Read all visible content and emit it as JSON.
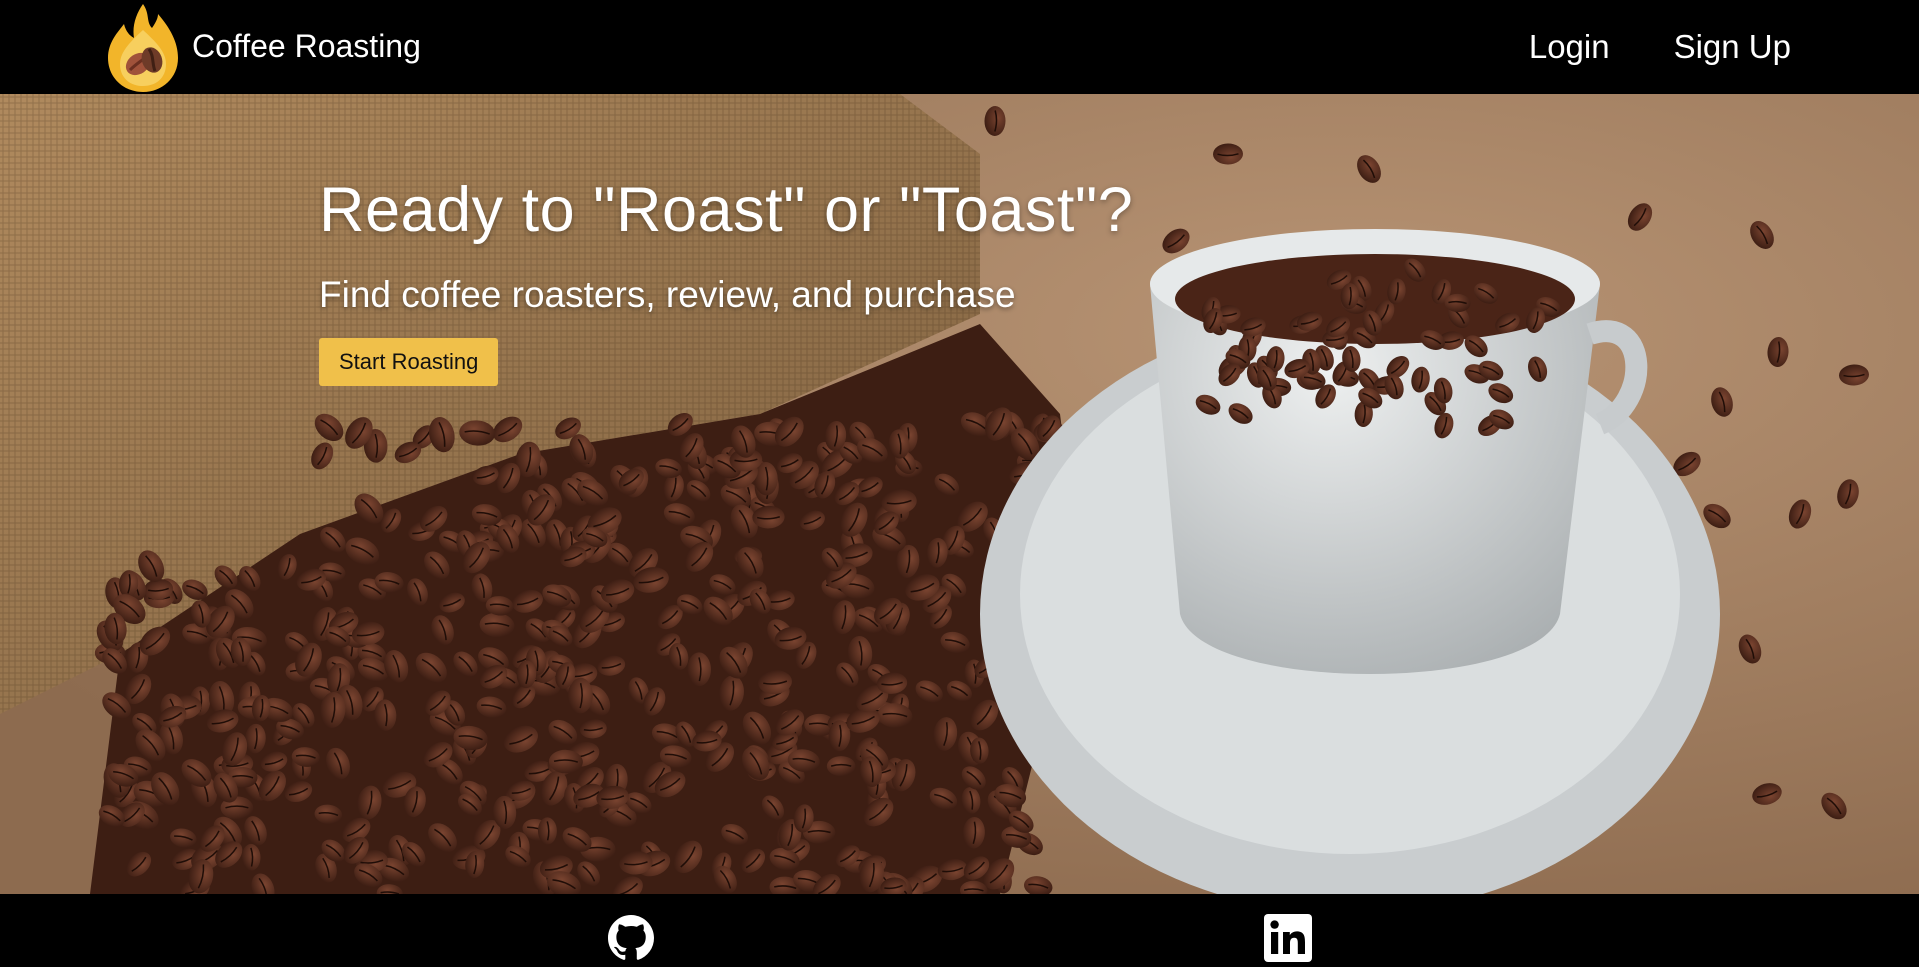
{
  "header": {
    "brand_name": "Coffee Roasting",
    "logo_icon": "flame-coffee-bean-icon",
    "nav": {
      "login": "Login",
      "signup": "Sign Up"
    }
  },
  "hero": {
    "title": "Ready to \"Roast\" or \"Toast\"?",
    "subtitle": "Find coffee roasters, review, and purchase",
    "cta_label": "Start Roasting",
    "background_image": "coffee-beans-sack-and-cup-photo"
  },
  "footer": {
    "icons": [
      "github-icon",
      "linkedin-icon"
    ]
  },
  "colors": {
    "header_bg": "#000000",
    "footer_bg": "#000000",
    "cta_bg": "#f0c04a",
    "text": "#ffffff"
  }
}
